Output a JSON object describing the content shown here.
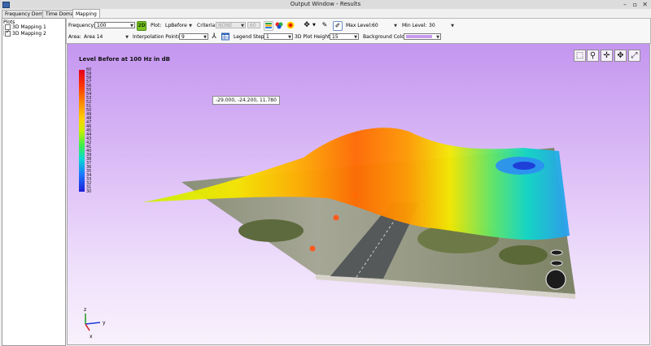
{
  "window": {
    "title": "Output Window - Results",
    "minimize": "–",
    "maximize": "▫",
    "close": "✕"
  },
  "tabs": [
    {
      "label": "Frequency Domain"
    },
    {
      "label": "Time Domain"
    },
    {
      "label": "Mapping"
    }
  ],
  "plots": {
    "label": "Plots",
    "items": [
      {
        "label": "3D Mapping 1",
        "checked": false
      },
      {
        "label": "3D Mapping 2",
        "checked": true
      }
    ]
  },
  "toolbar": {
    "frequency_label": "Frequency:",
    "frequency_value": "100",
    "mode_button": "2D",
    "plot_label": "Plot:",
    "plot_value": "LpBefore",
    "criteria_label": "Criteria:",
    "criteria_value": "NONE",
    "criteria_num": "60",
    "max_level_label": "Max Level:",
    "max_level_value": "60",
    "min_level_label": "Min Level:",
    "min_level_value": "30",
    "area_label": "Area:",
    "area_value": "Area 14",
    "interp_label": "Interpolation Points:",
    "interp_value": "9",
    "legend_step_label": "Legend Step:",
    "legend_step_value": "1",
    "plot_height_label": "3D Plot Height:",
    "plot_height_value": "15",
    "bg_color_label": "Background Color:",
    "bg_color_value": "#c89af0"
  },
  "viewport": {
    "legend_title": "Level Before at 100 Hz in dB",
    "legend_ticks": [
      "60",
      "59",
      "58",
      "57",
      "56",
      "55",
      "54",
      "53",
      "52",
      "51",
      "50",
      "49",
      "48",
      "47",
      "46",
      "45",
      "44",
      "43",
      "42",
      "41",
      "40",
      "39",
      "38",
      "37",
      "36",
      "35",
      "34",
      "33",
      "32",
      "31",
      "30"
    ],
    "tooltip": "-29.000, -24.200, 11.780",
    "axis": {
      "x": "x",
      "y": "y",
      "z": "z"
    }
  },
  "colors": {
    "accent": "#7cc324",
    "viewport_bg": "#c496f0"
  }
}
